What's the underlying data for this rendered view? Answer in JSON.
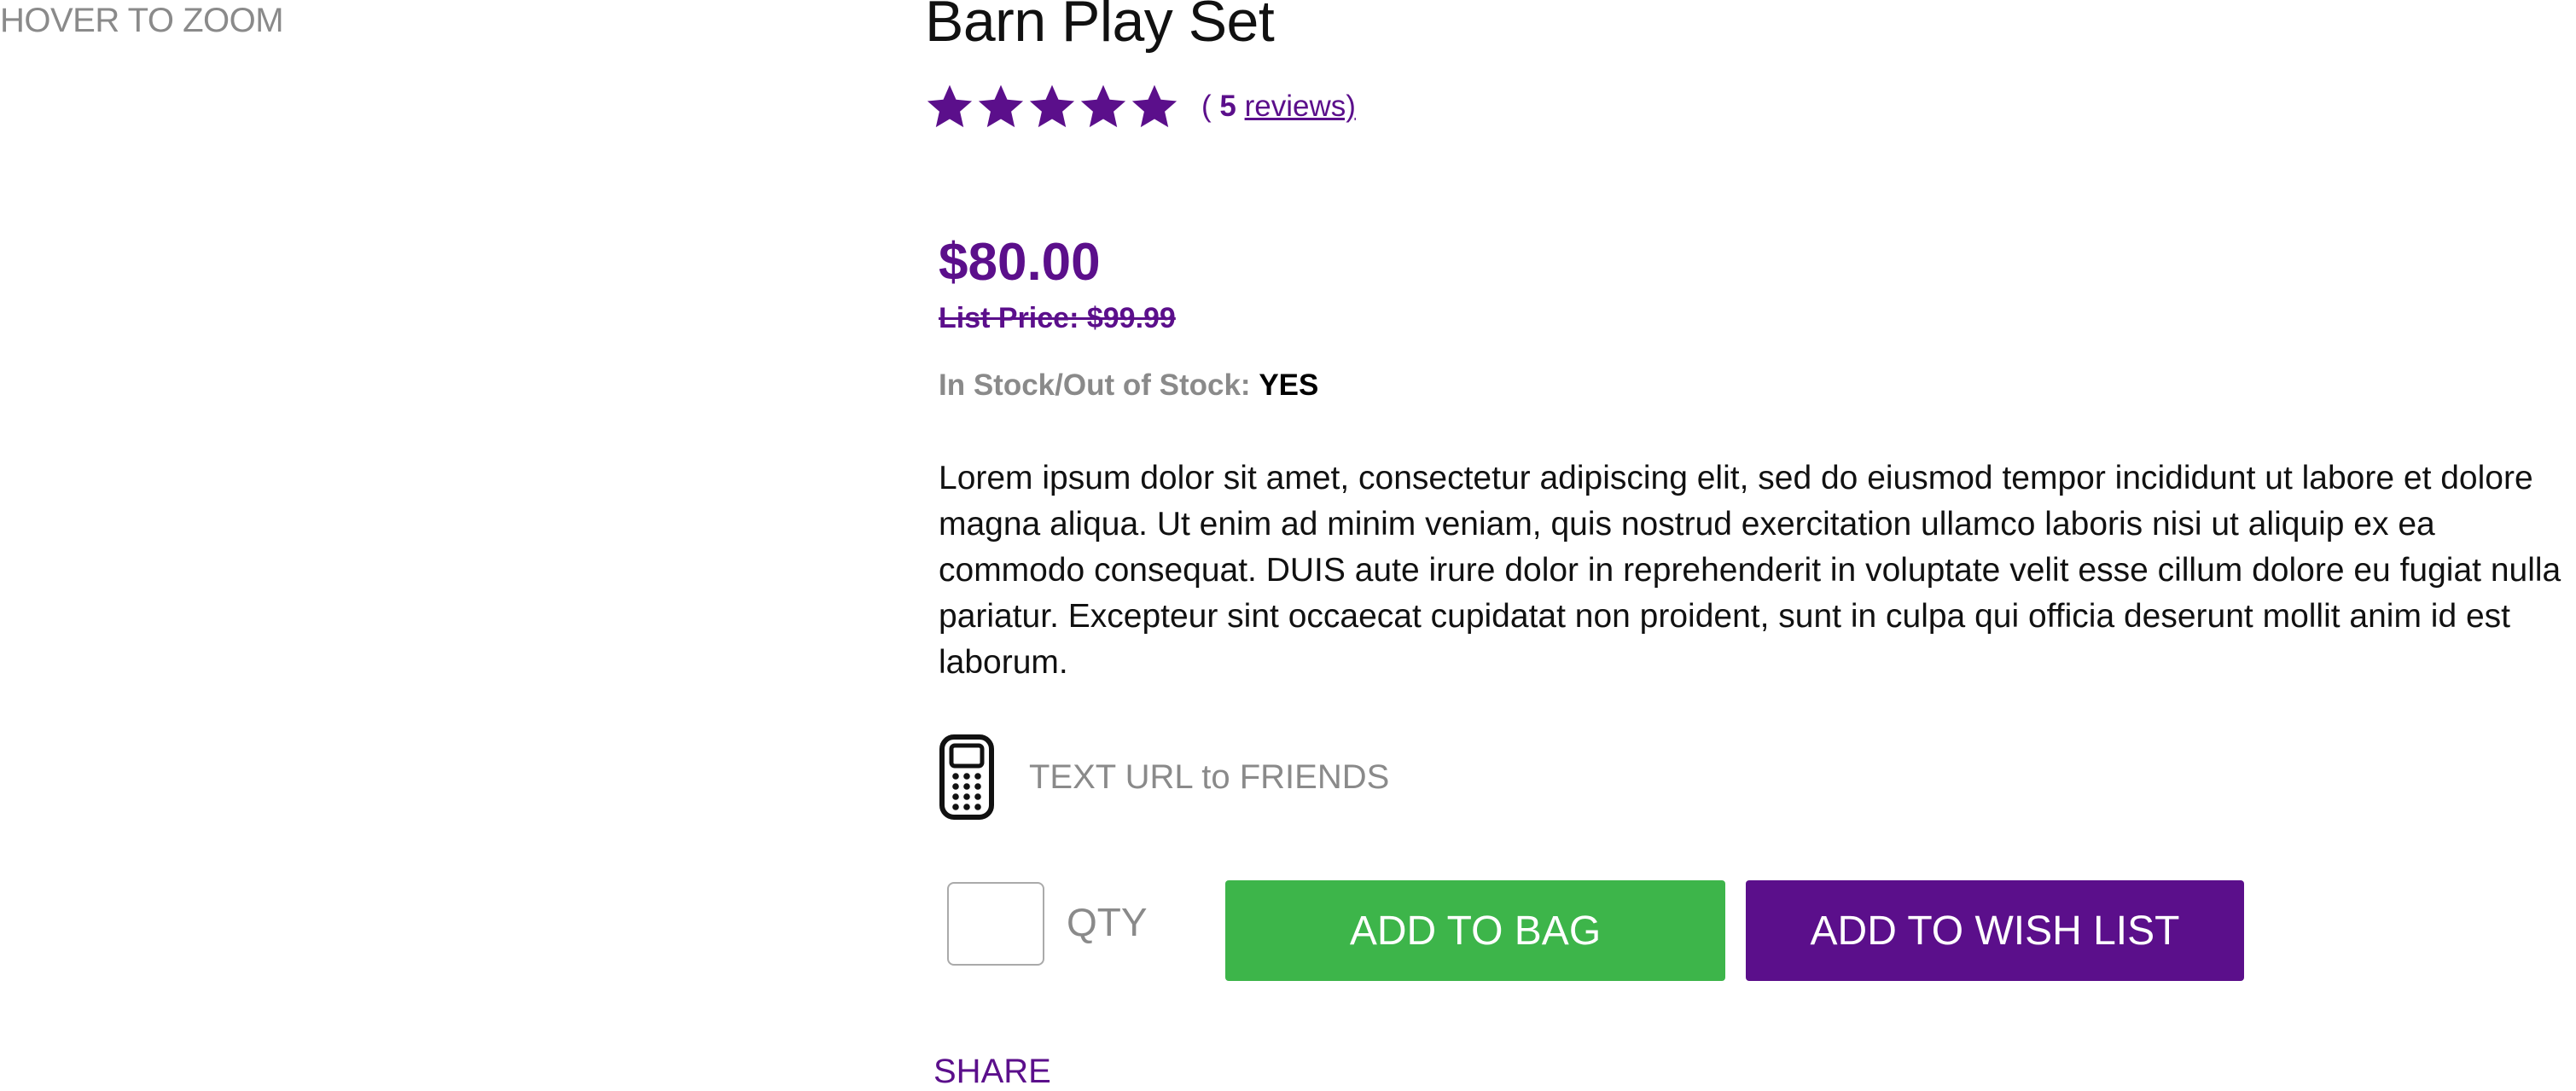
{
  "image_area": {
    "hover_label": "HOVER TO ZOOM"
  },
  "product": {
    "title": "Barn Play Set",
    "rating": {
      "stars": 5,
      "max_stars": 5,
      "review_prefix": "( ",
      "review_count": "5",
      "review_link": "reviews)",
      "star_color": "#5b0f8b"
    },
    "price": "$80.00",
    "list_price": "List Price: $99.99",
    "stock": {
      "label": "In Stock/Out of Stock:",
      "value": "YES"
    },
    "description": "Lorem ipsum dolor sit amet, consectetur adipiscing elit, sed do eiusmod tempor incididunt ut labore et dolore magna aliqua. Ut enim ad minim veniam, quis nostrud exercitation ullamco laboris nisi ut aliquip ex ea commodo consequat. DUIS aute irure dolor in reprehenderit in voluptate velit esse cillum dolore eu fugiat nulla pariatur. Excepteur sint occaecat cupidatat non proident, sunt in culpa qui officia deserunt mollit anim id est laborum."
  },
  "text_url": {
    "icon": "mobile-phone-icon",
    "label": "TEXT URL to FRIENDS"
  },
  "purchase": {
    "qty_label": "QTY",
    "qty_value": "",
    "add_to_bag": "ADD TO BAG",
    "add_to_wish_list": "ADD TO WISH LIST"
  },
  "share": {
    "label": "SHARE"
  },
  "colors": {
    "brand_purple": "#5b0f8b",
    "bag_green": "#3db54a",
    "muted_gray": "#8a8a8a"
  }
}
